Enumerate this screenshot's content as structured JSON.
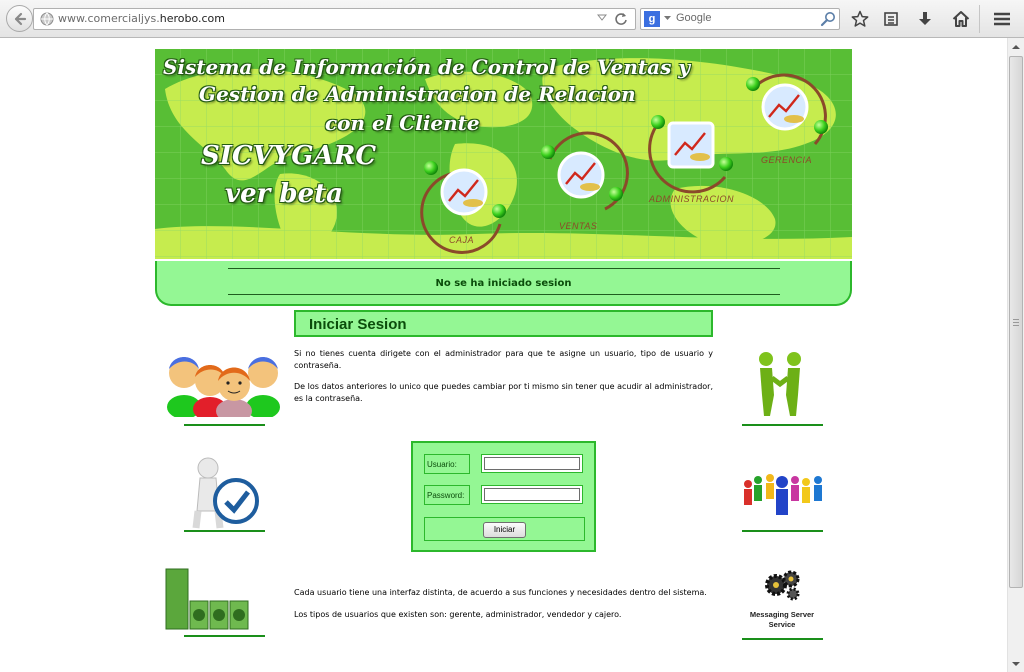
{
  "browser": {
    "url_prefix": "www.comercialjys.",
    "url_domain": "herobo.com",
    "search_engine_logo": "g",
    "search_placeholder": "Google",
    "icons": [
      "back-arrow-icon",
      "globe-icon",
      "dropdown-arrow-icon",
      "reload-icon",
      "google-logo-icon",
      "search-magnifier-icon",
      "star-icon",
      "reading-list-icon",
      "download-icon",
      "home-icon",
      "menu-icon"
    ]
  },
  "banner": {
    "title_line1": "Sistema de Información de Control de Ventas y",
    "title_line2": "Gestion de Administracion de Relacion",
    "title_line3": "con el Cliente",
    "acronym": "SICVYGARC",
    "version": "ver beta",
    "nodes": [
      {
        "label": "CAJA"
      },
      {
        "label": "VENTAS"
      },
      {
        "label": "ADMINISTRACION"
      },
      {
        "label": "GERENCIA"
      }
    ]
  },
  "status": {
    "text": "No se ha iniciado sesion"
  },
  "section": {
    "title": "Iniciar Sesion"
  },
  "paragraphs": {
    "p1": "Si no tienes cuenta dirigete con el administrador para que te asigne un usuario, tipo de usuario y contraseña.",
    "p2": "De los datos anteriores lo unico que puedes cambiar por ti mismo sin tener que acudir al administrador, es la contraseña.",
    "p3": "Cada usuario tiene una interfaz distinta, de acuerdo a sus funciones y necesidades dentro del sistema.",
    "p4": "Los tipos de usuarios que existen son: gerente, administrador, vendedor y cajero."
  },
  "login": {
    "user_label": "Usuario:",
    "user_value": "",
    "password_label": "Password:",
    "password_value": "",
    "submit_label": "Iniciar"
  },
  "side_images": {
    "messaging_label": "Messaging Server Service"
  },
  "colors": {
    "panel_green": "#94f794",
    "border_green": "#2cb82c",
    "text_dark_green": "#0b4d0b",
    "banner_green": "#5ec23a"
  }
}
